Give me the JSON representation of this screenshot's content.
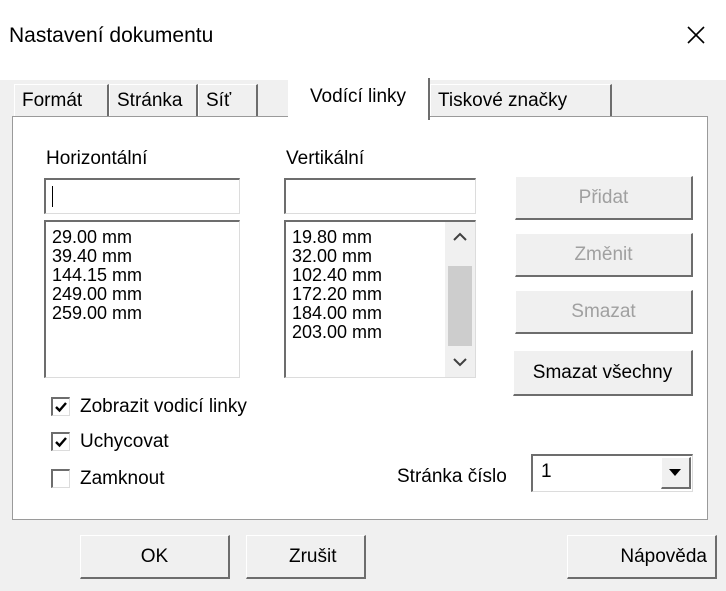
{
  "window": {
    "title": "Nastavení dokumentu",
    "close_icon": "close-icon"
  },
  "tabs": [
    {
      "label": "Formát",
      "active": false
    },
    {
      "label": "Stránka",
      "active": false
    },
    {
      "label": "Síť",
      "active": false
    },
    {
      "label": "Vodící linky",
      "active": true
    },
    {
      "label": "Tiskové značky",
      "active": false
    }
  ],
  "horizontal": {
    "label": "Horizontální",
    "input_value": "",
    "items": [
      "29.00 mm",
      "39.40 mm",
      "144.15 mm",
      "249.00 mm",
      "259.00 mm"
    ]
  },
  "vertical": {
    "label": "Vertikální",
    "input_value": "",
    "items": [
      "19.80 mm",
      "32.00 mm",
      "102.40 mm",
      "172.20 mm",
      "184.00 mm",
      "203.00 mm"
    ]
  },
  "actions": {
    "add": "Přidat",
    "change": "Změnit",
    "delete": "Smazat",
    "delete_all": "Smazat všechny"
  },
  "checkboxes": {
    "show_guides": {
      "label": "Zobrazit vodicí linky",
      "checked": true
    },
    "snap": {
      "label": "Uchycovat",
      "checked": true
    },
    "lock": {
      "label": "Zamknout",
      "checked": false
    }
  },
  "page_number": {
    "label": "Stránka číslo",
    "value": "1"
  },
  "footer": {
    "ok": "OK",
    "cancel": "Zrušit",
    "help": "Nápověda"
  },
  "colors": {
    "disabled_text": "#a0a0a0",
    "panel_bg": "#ffffff",
    "dialog_bg": "#f0f0f0"
  }
}
